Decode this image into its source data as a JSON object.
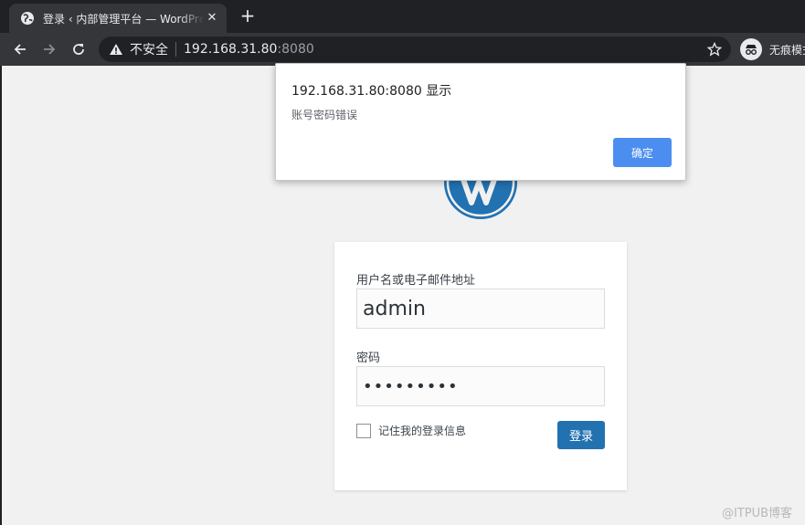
{
  "browser": {
    "tab_title": "登录 ‹ 内部管理平台 — WordPress",
    "close_glyph": "✕",
    "new_tab_glyph": "+",
    "insecure_label": "不安全",
    "url_host": "192.168.31.80",
    "url_port": ":8080",
    "incognito_label": "无痕模式"
  },
  "alert": {
    "title": "192.168.31.80:8080 显示",
    "message": "账号密码错误",
    "ok_label": "确定"
  },
  "login": {
    "username_label": "用户名或电子邮件地址",
    "username_value": "admin",
    "password_label": "密码",
    "password_value": "•••••••••",
    "remember_label": "记住我的登录信息",
    "submit_label": "登录"
  },
  "watermark": "@ITPUB博客",
  "colors": {
    "wp_blue": "#2271b1",
    "alert_button": "#4c8ef0",
    "chrome_dark": "#202124",
    "chrome_toolbar": "#35363a"
  }
}
